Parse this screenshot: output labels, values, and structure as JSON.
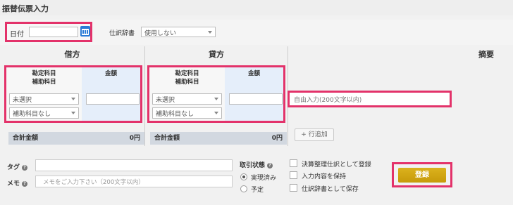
{
  "page_title": "振替伝票入力",
  "date": {
    "label": "日付",
    "value": ""
  },
  "journal_dictionary": {
    "label": "仕訳辞書",
    "selected": "使用しない"
  },
  "debit": {
    "header": "借方",
    "account_header_line1": "勘定科目",
    "account_header_line2": "補助科目",
    "amount_header": "金額",
    "account_select": "未選択",
    "sub_account_select": "補助科目なし",
    "amount_value": "",
    "total_label": "合計金額",
    "total_value": "0円"
  },
  "credit": {
    "header": "貸方",
    "account_header_line1": "勘定科目",
    "account_header_line2": "補助科目",
    "amount_header": "金額",
    "account_select": "未選択",
    "sub_account_select": "補助科目なし",
    "amount_value": "",
    "total_label": "合計金額",
    "total_value": "0円"
  },
  "summary": {
    "header": "摘要",
    "placeholder": "自由入力(200文字以内)"
  },
  "add_row_button": "+ 行追加",
  "tag": {
    "label": "タグ",
    "value": ""
  },
  "memo": {
    "label": "メモ",
    "placeholder": "メモをご入力下さい（200文字以内）"
  },
  "transaction_status": {
    "label": "取引状態",
    "options": [
      "実現済み",
      "予定"
    ],
    "selected": "実現済み"
  },
  "checkboxes": [
    "決算整理仕訳として登録",
    "入力内容を保持",
    "仕訳辞書として保存"
  ],
  "register_button": "登録",
  "colors": {
    "highlight": "#e3326a",
    "register": "#d1a70f",
    "amount_bg": "#e5eefa",
    "calendar": "#2a7bd6"
  }
}
